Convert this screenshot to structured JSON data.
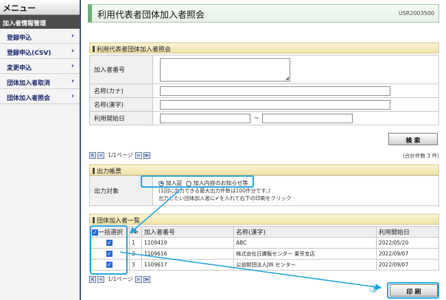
{
  "sidebar": {
    "menu_title": "メニュー",
    "section_title": "加入者情報管理",
    "items": [
      {
        "label": "登録申込"
      },
      {
        "label": "登録申込(CSV)"
      },
      {
        "label": "変更申込"
      },
      {
        "label": "団体加入者取消"
      },
      {
        "label": "団体加入者照会"
      }
    ],
    "chevron": "›"
  },
  "header": {
    "title": "利用代表者団体加入者照会",
    "screen_code": "USR2003500"
  },
  "search": {
    "section_title": "利用代表者団体加入者照会",
    "fields": {
      "member_no_label": "加入者番号",
      "name_kana_label": "名称(カナ)",
      "name_kanji_label": "名称(漢字)",
      "start_date_label": "利用開始日",
      "range_sep": "~"
    },
    "search_button": "検 索",
    "total": "(合計件数 3 件)"
  },
  "pager": {
    "first": "K",
    "prev": "<",
    "page_info": "1/1ページ",
    "next": ">",
    "last": "≫"
  },
  "output": {
    "section_title": "出力帳票",
    "label": "出力対象",
    "options": [
      {
        "label": "加入証",
        "selected": true
      },
      {
        "label": "加入内容のお知らせ等",
        "selected": false
      }
    ],
    "note1": "(1回に出力できる最大出力件数は100件分です。)",
    "note2": "出力したい団体加入者に✔を入れて右下の印刷をクリック"
  },
  "list": {
    "section_title": "団体加入者一覧",
    "headers": {
      "select_all": "一括選択",
      "no": "№",
      "member_no": "加入者番号",
      "name": "名称(漢字)",
      "start": "利用開始日"
    },
    "rows": [
      {
        "no": "1",
        "member_no": "1109419",
        "name": "ABC",
        "start": "2022/05/20",
        "checked": true
      },
      {
        "no": "2",
        "member_no": "1109616",
        "name": "株式会社日廣販センター 東京支店",
        "start": "2022/09/07",
        "checked": true
      },
      {
        "no": "3",
        "member_no": "1109617",
        "name": "公益財団法人JW センター",
        "start": "2022/09/07",
        "checked": true
      }
    ]
  },
  "print_button": "印 刷",
  "annotation": {
    "step_label": "③",
    "color": "#1fa3dd"
  },
  "colors": {
    "sidebar_link": "#1b2a6e",
    "checkbox": "#2a6bd6",
    "title_accent": "#6fae7a",
    "section_bg": "#f1e3a8"
  }
}
